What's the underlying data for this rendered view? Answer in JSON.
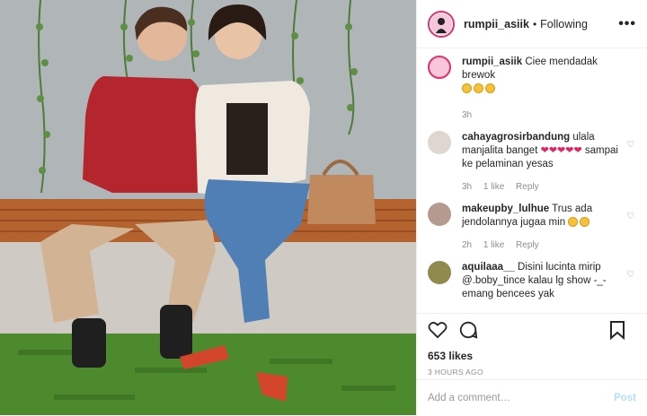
{
  "post": {
    "username": "rumpii_asiik",
    "separator": "•",
    "follow_status": "Following",
    "more_label": "•••",
    "likes": "653 likes",
    "time_ago": "3 HOURS AGO"
  },
  "caption": {
    "username": "rumpii_asiik",
    "text": "Ciee mendadak brewok",
    "emoji_count": 3,
    "time": "3h"
  },
  "comments": [
    {
      "username": "cahayagrosirbandung",
      "text_before": "ulala manjalita banget",
      "hearts": 5,
      "text_after": "sampai ke pelaminan yesas",
      "time": "3h",
      "likes": "1 like",
      "reply": "Reply"
    },
    {
      "username": "makeupby_lulhue",
      "text": "Trus ada jendolannya jugaa min",
      "emoji_count": 2,
      "time": "2h",
      "likes": "1 like",
      "reply": "Reply"
    },
    {
      "username": "aquilaaa__",
      "text": "Disini lucinta mirip @.boby_tince kalau lg show -_- emang bencees yak"
    }
  ],
  "add_comment": {
    "placeholder": "Add a comment…",
    "post_label": "Post"
  },
  "colors": {
    "follow_ring": "#e1306c",
    "post_disabled": "#b2dffc",
    "heart": "#e0245e"
  }
}
